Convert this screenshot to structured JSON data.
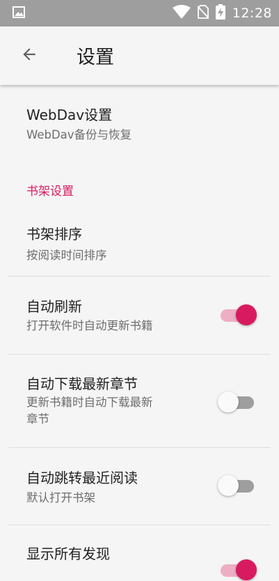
{
  "status_bar": {
    "time": "12:28",
    "icons": [
      "image-icon",
      "wifi-icon",
      "no-sim-icon",
      "battery-charging-icon"
    ]
  },
  "toolbar": {
    "back_icon": "arrow-left-icon",
    "title": "设置"
  },
  "settings": {
    "webdav": {
      "title": "WebDav设置",
      "subtitle": "WebDav备份与恢复"
    },
    "section_bookshelf": "书架设置",
    "shelf_sort": {
      "title": "书架排序",
      "subtitle": "按阅读时间排序"
    },
    "auto_refresh": {
      "title": "自动刷新",
      "subtitle": "打开软件时自动更新书籍",
      "enabled": true
    },
    "auto_download": {
      "title": "自动下载最新章节",
      "subtitle_line1": "更新书籍时自动下载最新",
      "subtitle_line2": "章节",
      "enabled": false
    },
    "auto_jump": {
      "title": "自动跳转最近阅读",
      "subtitle": "默认打开书架",
      "enabled": false
    },
    "show_all_discover": {
      "title": "显示所有发现"
    }
  },
  "colors": {
    "accent": "#d81b60",
    "status_bar": "#9e9e9e",
    "background": "#f5f5f5"
  }
}
